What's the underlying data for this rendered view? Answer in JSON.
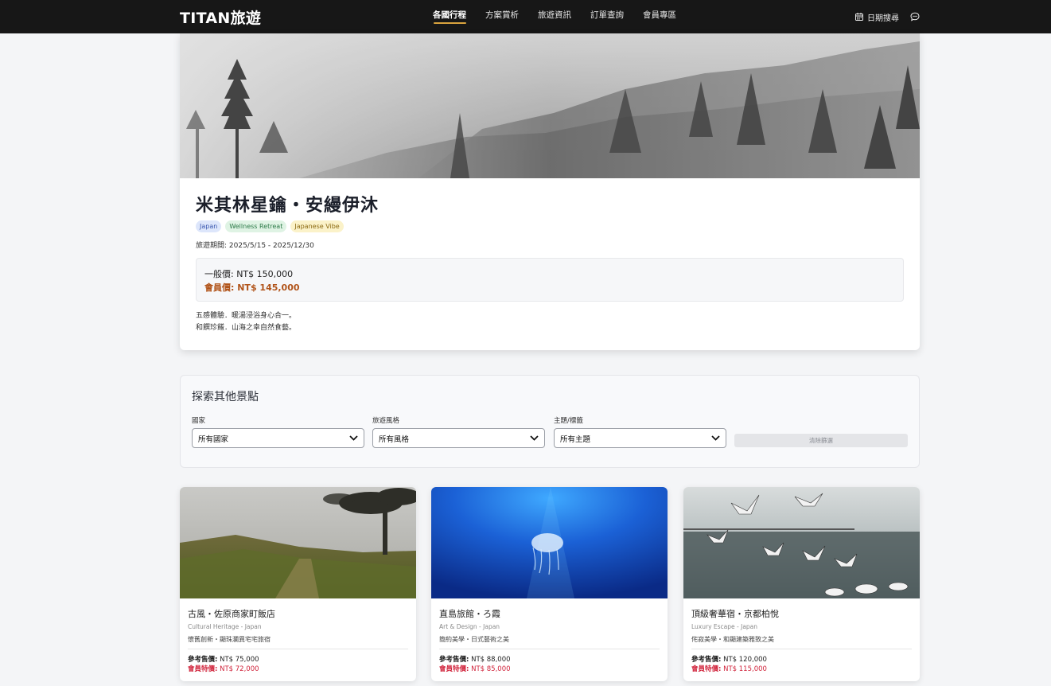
{
  "navbar": {
    "brand": "TITAN旅遊",
    "links": [
      "各國行程",
      "方案賞析",
      "旅遊資訊",
      "訂單查詢",
      "會員專區"
    ],
    "date_search": "日期搜尋"
  },
  "hero": {
    "title": "米其林星鑰・安縵伊沐",
    "tags": [
      "Japan",
      "Wellness Retreat",
      "Japanese Vibe"
    ],
    "period": "旅遊期間: 2025/5/15 - 2025/12/30",
    "price_normal": "一般價: NT$ 150,000",
    "price_member": "會員價: NT$ 145,000",
    "desc_lines": [
      "五感體驗．暖湯浸浴身心合一。",
      "和饌珍饈．山海之幸自然食藝。"
    ]
  },
  "filter": {
    "title": "探索其他景點",
    "country_label": "國家",
    "country_value": "所有國家",
    "style_label": "旅遊風格",
    "style_value": "所有風格",
    "theme_label": "主題/標籤",
    "theme_value": "所有主題",
    "clear_label": "清除篩選"
  },
  "cards": [
    {
      "title": "古風・佐原商家町飯店",
      "subtitle": "Cultural Heritage - Japan",
      "desc": "懷舊創新・顯珠瀾異宅宅旅宿",
      "price_label": "參考售價:",
      "price": "NT$ 75,000",
      "member_label": "會員特價:",
      "member_price": "NT$ 72,000"
    },
    {
      "title": "直島旅館・ろ霞",
      "subtitle": "Art & Design - Japan",
      "desc": "簡約美學・日式藝術之美",
      "price_label": "參考售價:",
      "price": "NT$ 88,000",
      "member_label": "會員特價:",
      "member_price": "NT$ 85,000"
    },
    {
      "title": "頂級奢華宿・京都柏悅",
      "subtitle": "Luxury Escape - Japan",
      "desc": "侘寂美學・和顯建築雅致之美",
      "price_label": "參考售價:",
      "price": "NT$ 120,000",
      "member_label": "會員特價:",
      "member_price": "NT$ 115,000"
    }
  ],
  "colors": {
    "nav_bg": "#171717",
    "accent": "#d9a33e",
    "member_price_hero": "#b1541a",
    "member_price_card": "#d0233b"
  },
  "icons": [
    "calendar-icon",
    "chat-icon",
    "chevron-down-icon"
  ]
}
